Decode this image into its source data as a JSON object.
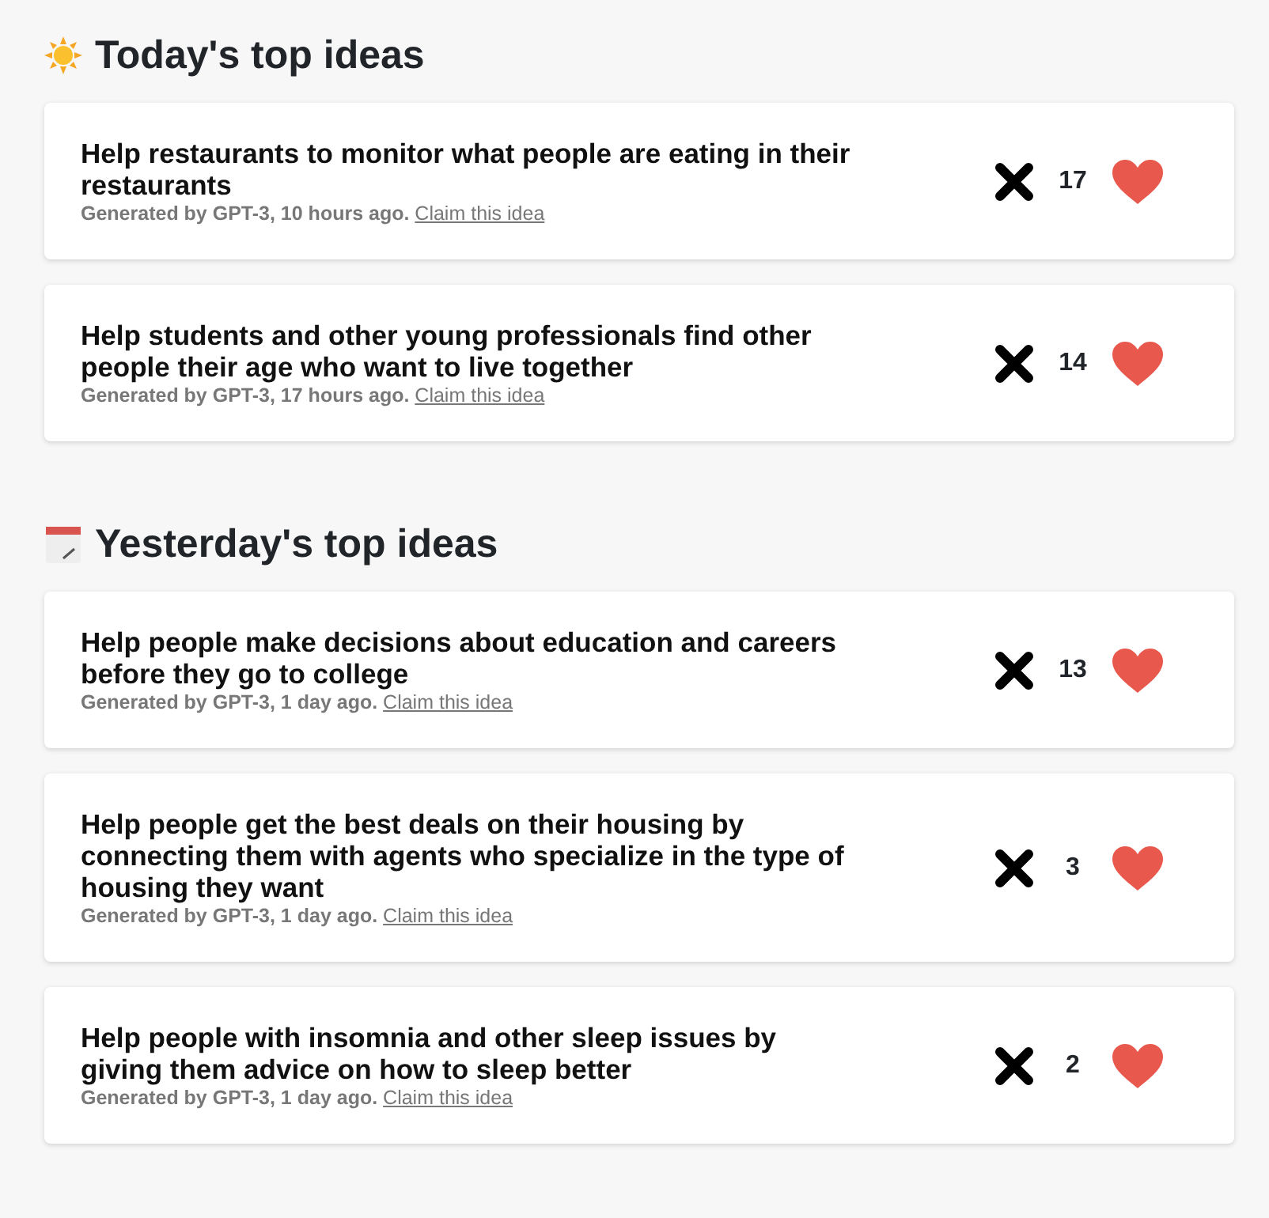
{
  "sections": [
    {
      "kind": "sun",
      "title": "Today's top ideas",
      "ideas": [
        {
          "title": "Help restaurants to monitor what people are eating in their restaurants",
          "meta": "Generated by GPT-3, 10 hours ago.",
          "link": "Claim this idea",
          "count": "17"
        },
        {
          "title": "Help students and other young professionals find other people their age who want to live together",
          "meta": "Generated by GPT-3, 17 hours ago.",
          "link": "Claim this idea",
          "count": "14"
        }
      ]
    },
    {
      "kind": "calendar",
      "title": "Yesterday's top ideas",
      "ideas": [
        {
          "title": "Help people make decisions about education and careers before they go to college",
          "meta": "Generated by GPT-3, 1 day ago.",
          "link": "Claim this idea",
          "count": "13"
        },
        {
          "title": "Help people get the best deals on their housing by connecting them with agents who specialize in the type of housing they want",
          "meta": "Generated by GPT-3, 1 day ago.",
          "link": "Claim this idea",
          "count": "3"
        },
        {
          "title": "Help people with insomnia and other sleep issues by giving them advice on how to sleep better",
          "meta": "Generated by GPT-3, 1 day ago.",
          "link": "Claim this idea",
          "count": "2"
        }
      ]
    }
  ]
}
